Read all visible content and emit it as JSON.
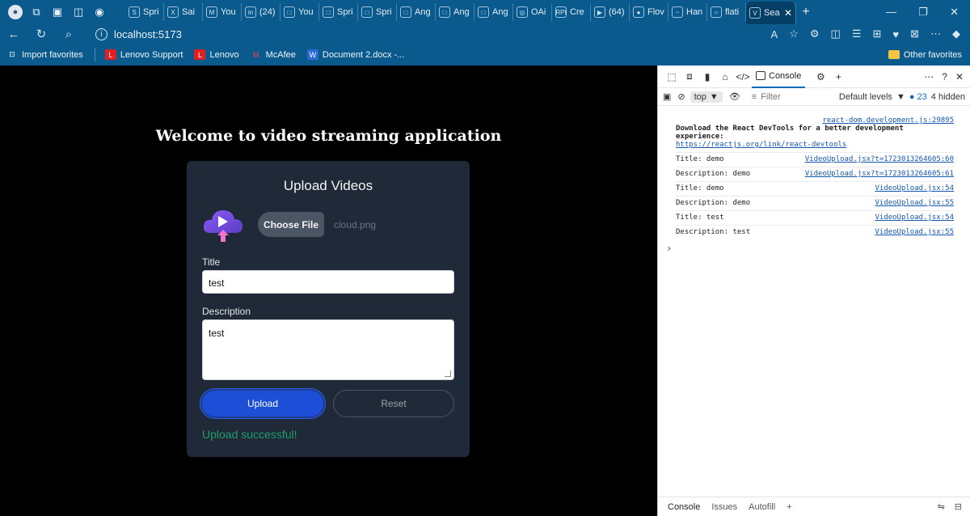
{
  "browser": {
    "tabs": [
      {
        "label": "Spri",
        "icon": "S"
      },
      {
        "label": "Sai",
        "icon": "X"
      },
      {
        "label": "You",
        "icon": "M"
      },
      {
        "label": "(24)",
        "icon": "in"
      },
      {
        "label": "You",
        "icon": "□"
      },
      {
        "label": "Spri",
        "icon": "□"
      },
      {
        "label": "Spri",
        "icon": "□"
      },
      {
        "label": "Ang",
        "icon": "□"
      },
      {
        "label": "Ang",
        "icon": "□"
      },
      {
        "label": "Ang",
        "icon": "□"
      },
      {
        "label": "OAi",
        "icon": "◎"
      },
      {
        "label": "Cre",
        "icon": "RPI"
      },
      {
        "label": "(64)",
        "icon": "▶"
      },
      {
        "label": "Flov",
        "icon": "●"
      },
      {
        "label": "Han",
        "icon": "~"
      },
      {
        "label": "flati",
        "icon": "○"
      },
      {
        "label": "Sea",
        "icon": "V"
      }
    ],
    "url": "localhost:5173",
    "bookmarks": [
      {
        "label": "Import favorites",
        "icon": "⊡"
      },
      {
        "label": "Lenovo Support",
        "icon": "L"
      },
      {
        "label": "Lenovo",
        "icon": "L"
      },
      {
        "label": "McAfee",
        "icon": "M"
      },
      {
        "label": "Document 2.docx -...",
        "icon": "W"
      }
    ],
    "other_favorites": "Other favorites"
  },
  "app": {
    "heading": "Welcome to video streaming application",
    "card_title": "Upload Videos",
    "choose_file_label": "Choose File",
    "file_name": "cloud.png",
    "title_label": "Title",
    "title_value": "test",
    "description_label": "Description",
    "description_value": "test",
    "upload_label": "Upload",
    "reset_label": "Reset",
    "status_message": "Upload successful!"
  },
  "devtools": {
    "console_tab": "Console",
    "context": "top",
    "filter_placeholder": "Filter",
    "levels": "Default levels",
    "message_count": "23",
    "hidden": "4 hidden",
    "first_source": "react-dom.development.js:29895",
    "first_message": "Download the React DevTools for a better development experience:",
    "first_link": "https://reactjs.org/link/react-devtools",
    "messages": [
      {
        "text": "Title: demo",
        "source": "VideoUpload.jsx?t=1723013264605:60"
      },
      {
        "text": "Description: demo",
        "source": "VideoUpload.jsx?t=1723013264605:61"
      },
      {
        "text": "Title: demo",
        "source": "VideoUpload.jsx:54"
      },
      {
        "text": "Description: demo",
        "source": "VideoUpload.jsx:55"
      },
      {
        "text": "Title: test",
        "source": "VideoUpload.jsx:54"
      },
      {
        "text": "Description: test",
        "source": "VideoUpload.jsx:55"
      }
    ],
    "bottom_tabs": [
      "Console",
      "Issues",
      "Autofill"
    ]
  }
}
